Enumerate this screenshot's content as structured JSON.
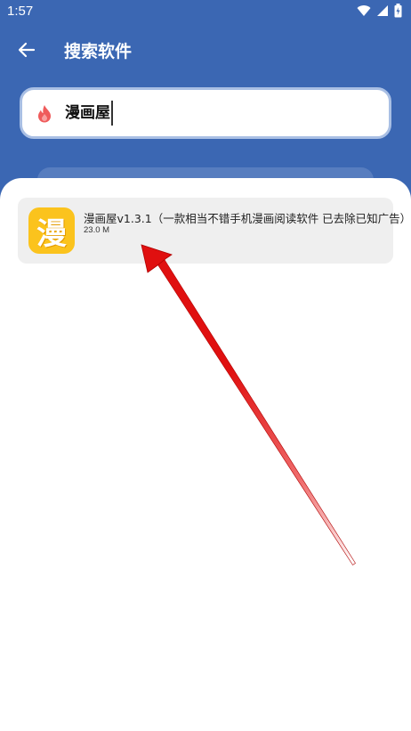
{
  "status_bar": {
    "time": "1:57",
    "icons": [
      "wifi-icon",
      "signal-icon",
      "battery-icon"
    ]
  },
  "header": {
    "title": "搜索软件",
    "back_icon": "arrow-left-icon"
  },
  "search": {
    "value": "漫画屋",
    "icon": "flame-icon"
  },
  "results": [
    {
      "icon_text": "漫",
      "title": "漫画屋v1.3.1（一款相当不错手机漫画阅读软件 已去除已知广告）",
      "size": "23.0 M"
    }
  ],
  "colors": {
    "header_bg": "#3b67b3",
    "search_border": "#a9bfe4",
    "card_bg": "#efefef",
    "app_icon_bg": "#fbc31d",
    "arrow": "#e01010",
    "flame": "#ef5b5b"
  }
}
